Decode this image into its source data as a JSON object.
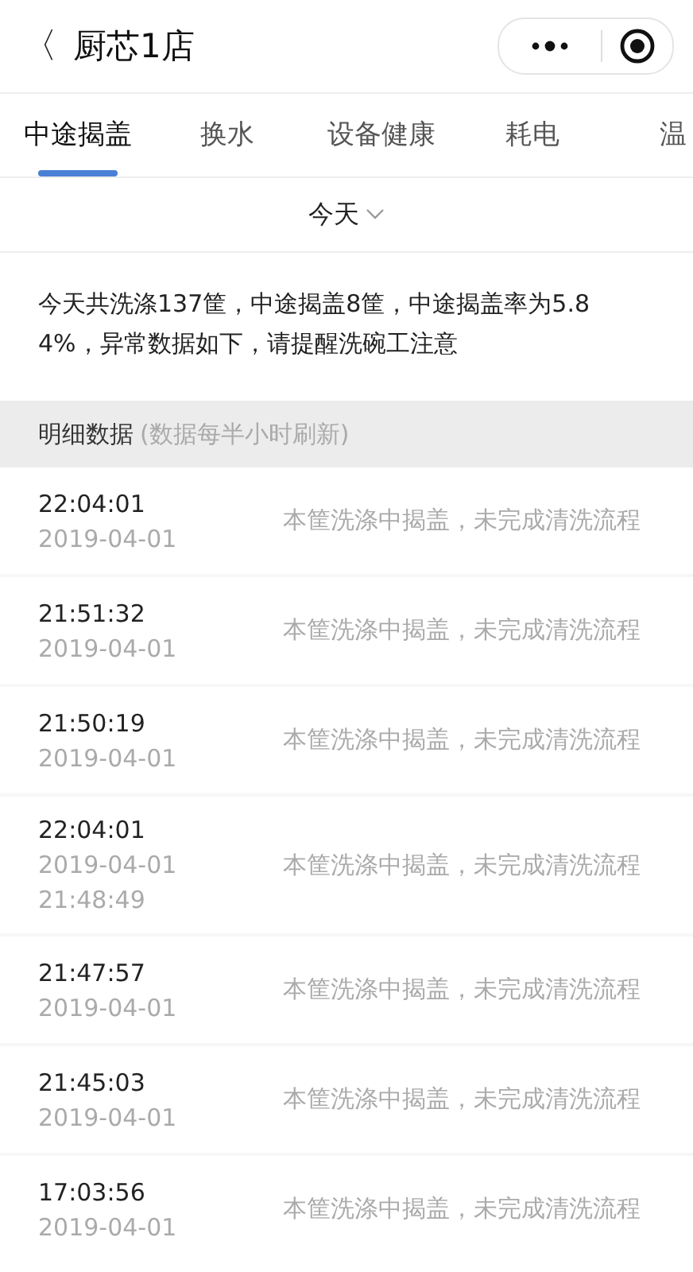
{
  "header": {
    "back": "〈",
    "title": "厨芯1店"
  },
  "tabs": [
    {
      "label": "中途揭盖",
      "selected": true
    },
    {
      "label": "换水",
      "selected": false
    },
    {
      "label": "设备健康",
      "selected": false
    },
    {
      "label": "耗电",
      "selected": false
    },
    {
      "label": "温",
      "selected": false
    }
  ],
  "date_filter": {
    "label": "今天"
  },
  "summary": "今天共洗涤137筐，中途揭盖8筐，中途揭盖率为5.84%，异常数据如下，请提醒洗碗工注意",
  "section": {
    "title": "明细数据",
    "note": "(数据每半小时刷新)"
  },
  "rows": [
    {
      "lines": [
        "22:04:01",
        "2019-04-01"
      ],
      "message": "本筐洗涤中揭盖，未完成清洗流程"
    },
    {
      "lines": [
        "21:51:32",
        "2019-04-01"
      ],
      "message": "本筐洗涤中揭盖，未完成清洗流程"
    },
    {
      "lines": [
        "21:50:19",
        "2019-04-01"
      ],
      "message": "本筐洗涤中揭盖，未完成清洗流程"
    },
    {
      "lines": [
        "22:04:01",
        "2019-04-01",
        "21:48:49"
      ],
      "message": "本筐洗涤中揭盖，未完成清洗流程"
    },
    {
      "lines": [
        "21:47:57",
        "2019-04-01"
      ],
      "message": "本筐洗涤中揭盖，未完成清洗流程"
    },
    {
      "lines": [
        "21:45:03",
        "2019-04-01"
      ],
      "message": "本筐洗涤中揭盖，未完成清洗流程"
    },
    {
      "lines": [
        "17:03:56",
        "2019-04-01"
      ],
      "message": "本筐洗涤中揭盖，未完成清洗流程"
    }
  ]
}
